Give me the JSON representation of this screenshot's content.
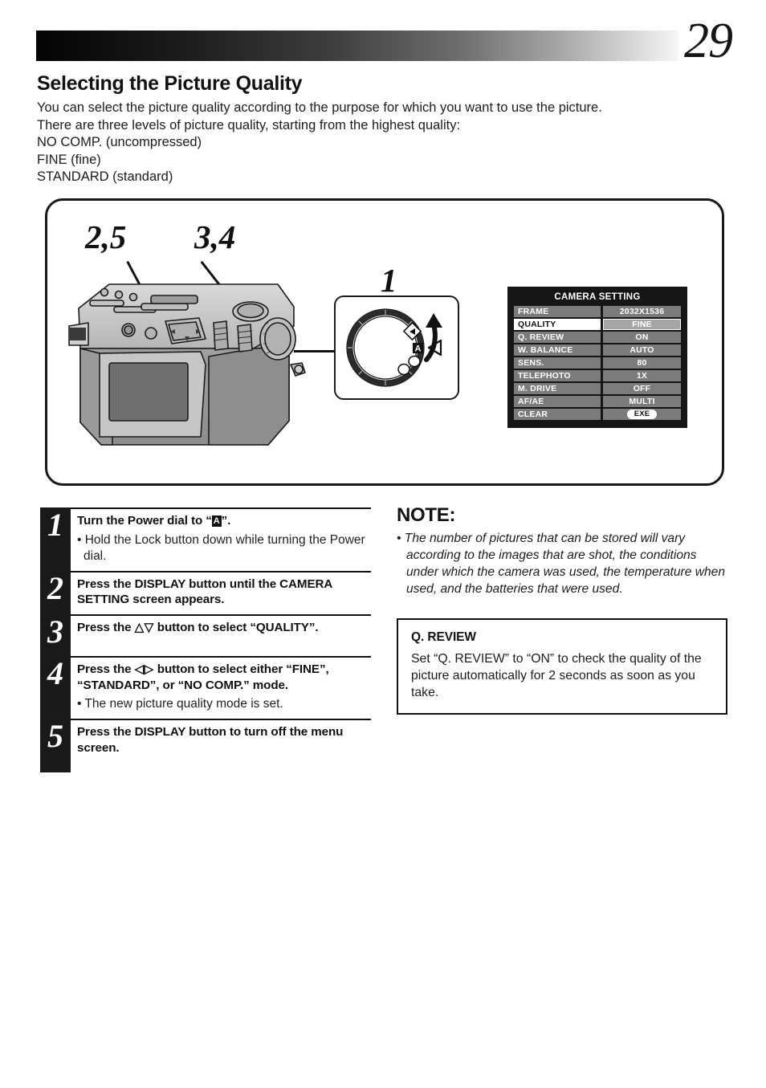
{
  "page": {
    "number": "29",
    "title": "Selecting the Picture Quality",
    "intro_lines": [
      "You can select the picture quality according to the purpose for which you want to use the picture.",
      "There are three levels of picture quality, starting from the highest quality:",
      "NO COMP. (uncompressed)",
      "FINE (fine)",
      "STANDARD (standard)"
    ]
  },
  "illustration": {
    "callouts": [
      {
        "id": "callout-25",
        "label": "2,5"
      },
      {
        "id": "callout-34",
        "label": "3,4"
      },
      {
        "id": "callout-1",
        "label": "1"
      }
    ],
    "dial_box": {
      "icons": [
        "play-diamond-icon",
        "auto-a-icon",
        "circle-icon",
        "circle-icon"
      ],
      "pointer": "left-triangle-pointer",
      "rotate_arrow": "curved-up-arrow"
    }
  },
  "osd": {
    "title": "CAMERA SETTING",
    "rows": [
      {
        "label": "FRAME",
        "value": "2032X1536",
        "selected": false,
        "button": false
      },
      {
        "label": "QUALITY",
        "value": "FINE",
        "selected": true,
        "button": false
      },
      {
        "label": "Q. REVIEW",
        "value": "ON",
        "selected": false,
        "button": false
      },
      {
        "label": "W. BALANCE",
        "value": "AUTO",
        "selected": false,
        "button": false
      },
      {
        "label": "SENS.",
        "value": "80",
        "selected": false,
        "button": false
      },
      {
        "label": "TELEPHOTO",
        "value": "1X",
        "selected": false,
        "button": false
      },
      {
        "label": "M. DRIVE",
        "value": "OFF",
        "selected": false,
        "button": false
      },
      {
        "label": "AF/AE",
        "value": "MULTI",
        "selected": false,
        "button": false
      },
      {
        "label": "CLEAR",
        "value": "EXE",
        "selected": false,
        "button": true
      }
    ],
    "colors": {
      "background": "#151515",
      "row": "#7b7b7b",
      "selected_label_bg": "#ffffff",
      "selected_value_bg": "#a6a6a6",
      "text": "#ffffff"
    }
  },
  "steps": [
    {
      "number": "1",
      "head_pre": "Turn the Power dial to “",
      "head_badge": "A",
      "head_post": "”.",
      "sub": "• Hold the Lock button down while turning the Power dial."
    },
    {
      "number": "2",
      "head": "Press the DISPLAY button until the CAMERA SETTING screen appears.",
      "sub": ""
    },
    {
      "number": "3",
      "head_pre": "Press the ",
      "head_arrows": "△▽",
      "head_post": " button to select “QUALITY”.",
      "sub": ""
    },
    {
      "number": "4",
      "head_pre": "Press the ",
      "head_arrows": "◁▷",
      "head_post": " button to select either “FINE”, “STANDARD”, or “NO COMP.” mode.",
      "sub": "• The new picture quality mode is set."
    },
    {
      "number": "5",
      "head": "Press the DISPLAY button to turn off the menu screen.",
      "sub": ""
    }
  ],
  "note": {
    "title": "NOTE:",
    "body": "• The number of pictures that can be stored will vary according to the images that are shot, the conditions under which the camera was used, the temperature when used, and the batteries that were used."
  },
  "qreview": {
    "title": "Q. REVIEW",
    "text": "Set “Q. REVIEW” to “ON” to check the quality of the picture automatically for 2 seconds as soon as you take."
  }
}
